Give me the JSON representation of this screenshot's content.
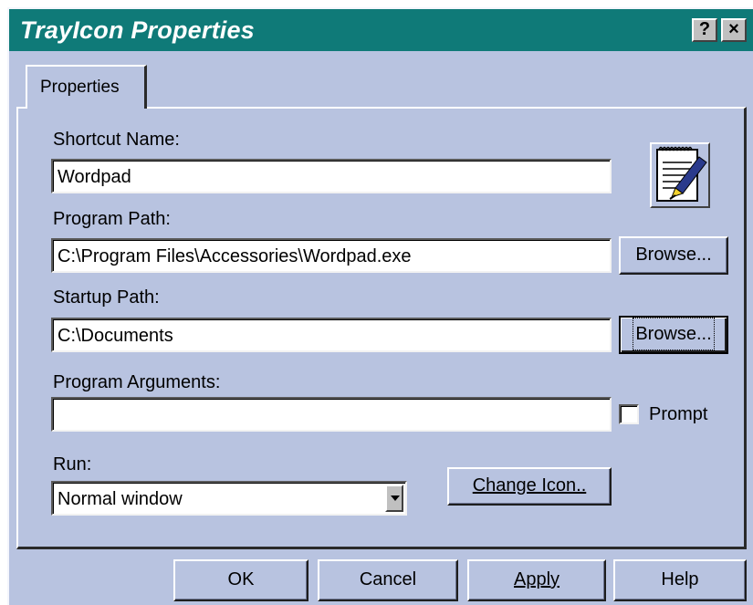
{
  "window": {
    "title": "TrayIcon Properties",
    "help_button": "?",
    "close_button": "×"
  },
  "tabs": [
    {
      "label": "Properties",
      "selected": true
    }
  ],
  "form": {
    "shortcut_name": {
      "label": "Shortcut Name:",
      "value": "Wordpad"
    },
    "program_path": {
      "label": "Program Path:",
      "value": "C:\\Program Files\\Accessories\\Wordpad.exe",
      "browse_label": "Browse..."
    },
    "startup_path": {
      "label": "Startup Path:",
      "value": "C:\\Documents",
      "browse_label": "Browse..."
    },
    "program_arguments": {
      "label": "Program Arguments:",
      "value": "",
      "prompt_label": "Prompt",
      "prompt_checked": false
    },
    "run": {
      "label": "Run:",
      "selected": "Normal window"
    },
    "change_icon_label": "Change Icon..",
    "icon": "wordpad-notepad-icon"
  },
  "footer": {
    "ok": "OK",
    "cancel": "Cancel",
    "apply": "Apply",
    "help": "Help"
  },
  "colors": {
    "titlebar": "#0f7a78",
    "face": "#b8c3e0"
  }
}
